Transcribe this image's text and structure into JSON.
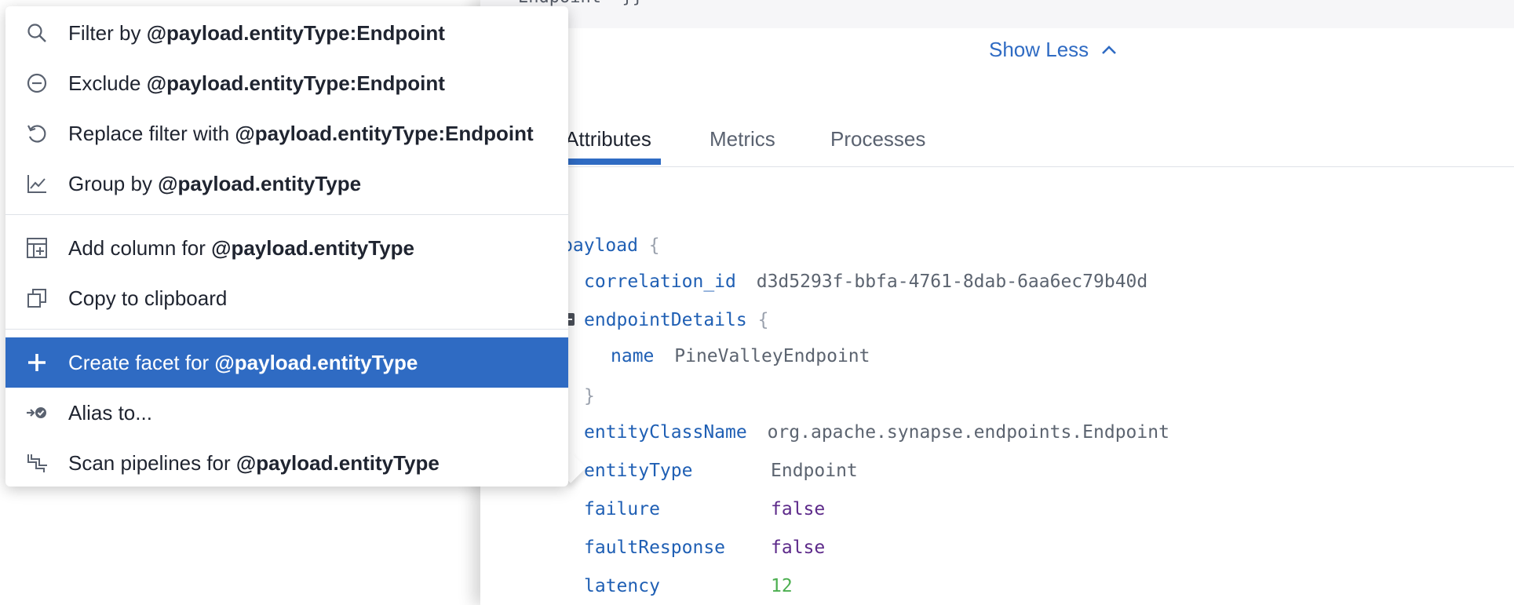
{
  "code_strip_text": "Endpoint\" }}",
  "show_less": "Show Less",
  "tabs": [
    {
      "label": "Attributes",
      "active": true
    },
    {
      "label": "Metrics",
      "active": false
    },
    {
      "label": "Processes",
      "active": false
    }
  ],
  "attributes": {
    "root_key": "payload",
    "open_brace": "{",
    "close_brace": "}",
    "correlation_id_key": "correlation_id",
    "correlation_id_value": "d3d5293f-bbfa-4761-8dab-6aa6ec79b40d",
    "endpointDetails_key": "endpointDetails",
    "name_key": "name",
    "name_value": "PineValleyEndpoint",
    "entityClassName_key": "entityClassName",
    "entityClassName_value": "org.apache.synapse.endpoints.Endpoint",
    "entityType_key": "entityType",
    "entityType_value": "Endpoint",
    "failure_key": "failure",
    "failure_value": "false",
    "faultResponse_key": "faultResponse",
    "faultResponse_value": "false",
    "latency_key": "latency",
    "latency_value": "12"
  },
  "menu": {
    "filter_prefix": "Filter by ",
    "filter_term": "@payload.entityType:Endpoint",
    "exclude_prefix": "Exclude ",
    "exclude_term": "@payload.entityType:Endpoint",
    "replace_prefix": "Replace filter with ",
    "replace_term": "@payload.entityType:Endpoint",
    "group_prefix": "Group by ",
    "group_term": "@payload.entityType",
    "addcol_prefix": "Add column for ",
    "addcol_term": "@payload.entityType",
    "copy_label": "Copy to clipboard",
    "facet_prefix": "Create facet for ",
    "facet_term": "@payload.entityType",
    "alias_label": "Alias to...",
    "scan_prefix": "Scan pipelines for ",
    "scan_term": "@payload.entityType"
  },
  "colors": {
    "accent": "#2f6bc3",
    "key": "#1f5fb4",
    "boolean": "#5d2a8a",
    "number": "#4caf50"
  }
}
